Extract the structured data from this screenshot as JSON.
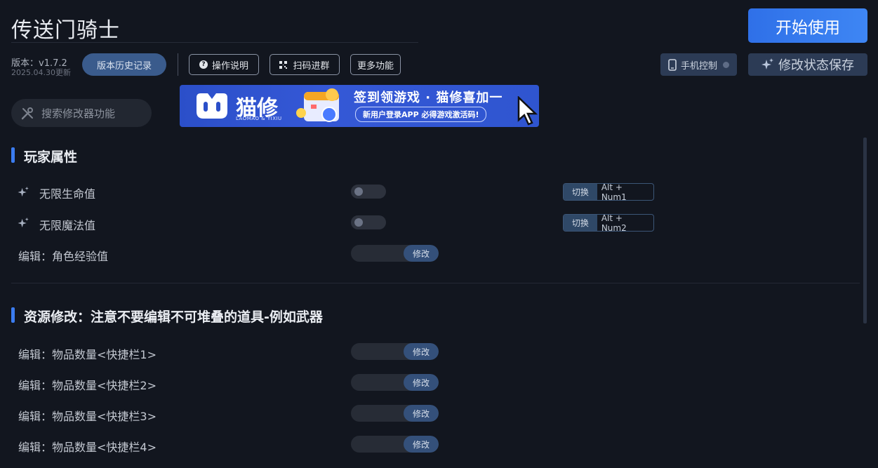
{
  "app": {
    "title": "传送门骑士",
    "version": "版本：v1.7.2",
    "date": "2025.04.30更新"
  },
  "toolbar": {
    "history_label": "版本历史记录",
    "help_label": "操作说明",
    "scan_label": "扫码进群",
    "more_label": "更多功能",
    "start_label": "开始使用",
    "phone_label": "手机控制",
    "save_label": "修改状态保存"
  },
  "search": {
    "placeholder": "搜索修改器功能"
  },
  "banner": {
    "brand": "猫修",
    "brand_sub": "LAOMAO & YIXIU",
    "headline": "签到领游戏 · 猫修喜加一",
    "subline": "新用户登录APP  必得游戏激活码!"
  },
  "sections": [
    {
      "title": "玩家属性",
      "rows": [
        {
          "label": "无限生命值",
          "hotkey_label": "切换",
          "hotkey": "Alt + Num1",
          "toggle_on": false
        },
        {
          "label": "无限魔法值",
          "hotkey_label": "切换",
          "hotkey": "Alt + Num2",
          "toggle_on": false
        },
        {
          "label": "编辑：角色经验值",
          "edit_label": "修改"
        }
      ]
    },
    {
      "title": "资源修改：注意不要编辑不可堆叠的道具-例如武器",
      "rows": [
        {
          "label": "编辑：物品数量<快捷栏1>",
          "edit_label": "修改"
        },
        {
          "label": "编辑：物品数量<快捷栏2>",
          "edit_label": "修改"
        },
        {
          "label": "编辑：物品数量<快捷栏3>",
          "edit_label": "修改"
        },
        {
          "label": "编辑：物品数量<快捷栏4>",
          "edit_label": "修改"
        }
      ]
    }
  ],
  "colors": {
    "accent": "#3b7cf0",
    "background": "#12161f",
    "button": "#2c3b55"
  }
}
